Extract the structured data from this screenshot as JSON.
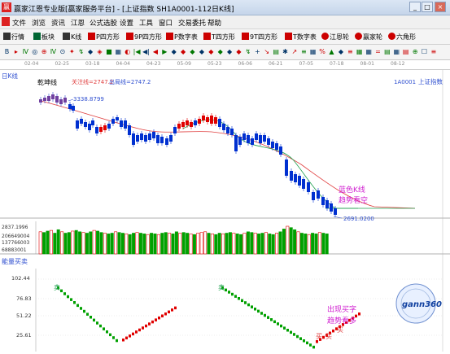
{
  "window": {
    "title": "赢家江恩专业版[赢家服务平台] - [上证指数  SH1A0001-112日K线]",
    "min": "_",
    "max": "□",
    "close": "×"
  },
  "menu": [
    "文件",
    "浏览",
    "资讯",
    "江恩",
    "公式选股",
    "设置",
    "工具",
    "窗口",
    "交易委托",
    "帮助"
  ],
  "toolbar": [
    "行情",
    "板块",
    "K线",
    "P四方形",
    "9P四方形",
    "P数字表",
    "T四方形",
    "9T四方形",
    "T数字表",
    "江恩轮",
    "赢家轮",
    "六角形"
  ],
  "toolbar2_icons": [
    "B",
    "▸",
    "Ⅳ",
    "◎",
    "⊕",
    "Ⅳ",
    "⊙",
    "✦",
    "↯",
    "◆",
    "◈",
    "■",
    "▦",
    "◐",
    "|◀",
    "◀|",
    "◀",
    "▶",
    "◆",
    "◆",
    "◆",
    "◆",
    "◆",
    "◆",
    "◆",
    "◆",
    "↯",
    "+",
    "↘",
    "▤",
    "✱",
    "↗",
    "≡",
    "▦",
    "%",
    "▲",
    "◆",
    "≡",
    "▦",
    "▦",
    "=",
    "▤",
    "▦",
    "▤",
    "⊕",
    "☐",
    "≡"
  ],
  "date_labels": [
    "02-04",
    "02-25",
    "03-18",
    "04-04",
    "04-23",
    "05-09",
    "05-23",
    "06-06",
    "06-21",
    "07-05",
    "07-18",
    "08-01",
    "08-12"
  ],
  "chart": {
    "period_label": "日K线",
    "name": "乾坤线",
    "focus_label": "关注线=2747.2",
    "exit_label": "出局线=2747.2",
    "code_label": "1A0001",
    "index_label": "上证指数",
    "high_label": "3338.8799",
    "low_label": "2691.0200",
    "annotation_line1": "蓝色K线",
    "annotation_line2": "趋势看空"
  },
  "volume": {
    "axis_labels": [
      "2837.1996",
      "206649004",
      "137766003",
      "68883001"
    ],
    "values": [
      160,
      155,
      165,
      170,
      150,
      175,
      160,
      150,
      155,
      165,
      170,
      160,
      155,
      150,
      160,
      170,
      165,
      155,
      150,
      145,
      150,
      160,
      155,
      150,
      145,
      140,
      150,
      155,
      150,
      145,
      140,
      150,
      145,
      140,
      150,
      155,
      150,
      145,
      160,
      150,
      155,
      150,
      145,
      140,
      150,
      155,
      160,
      150,
      145,
      140,
      150,
      145,
      150,
      155,
      150,
      145,
      140,
      150,
      160,
      155,
      150,
      145,
      150,
      155,
      145,
      140,
      150,
      160,
      180,
      200,
      190,
      175,
      160,
      150,
      145,
      140,
      150,
      145,
      155,
      150,
      145
    ]
  },
  "indicator": {
    "title": "能量买卖",
    "axis_labels": [
      "102.44",
      "76.83",
      "51.22",
      "25.61"
    ],
    "buy_sell_top": [
      "卖",
      "卖"
    ],
    "buy_sell_bottom": [
      "买",
      "买",
      "买"
    ],
    "annotation_line1": "出现买字",
    "annotation_line2": "趋势看多",
    "badge_text": "gann360"
  },
  "colors": {
    "up": "#e00000",
    "down": "#0030d0",
    "volume_up": "#e00000",
    "volume_down": "#00a000",
    "ma": "#e04040",
    "ma2": "#20a050",
    "annotation": "#d020d0",
    "blue_text": "#3050d0"
  }
}
